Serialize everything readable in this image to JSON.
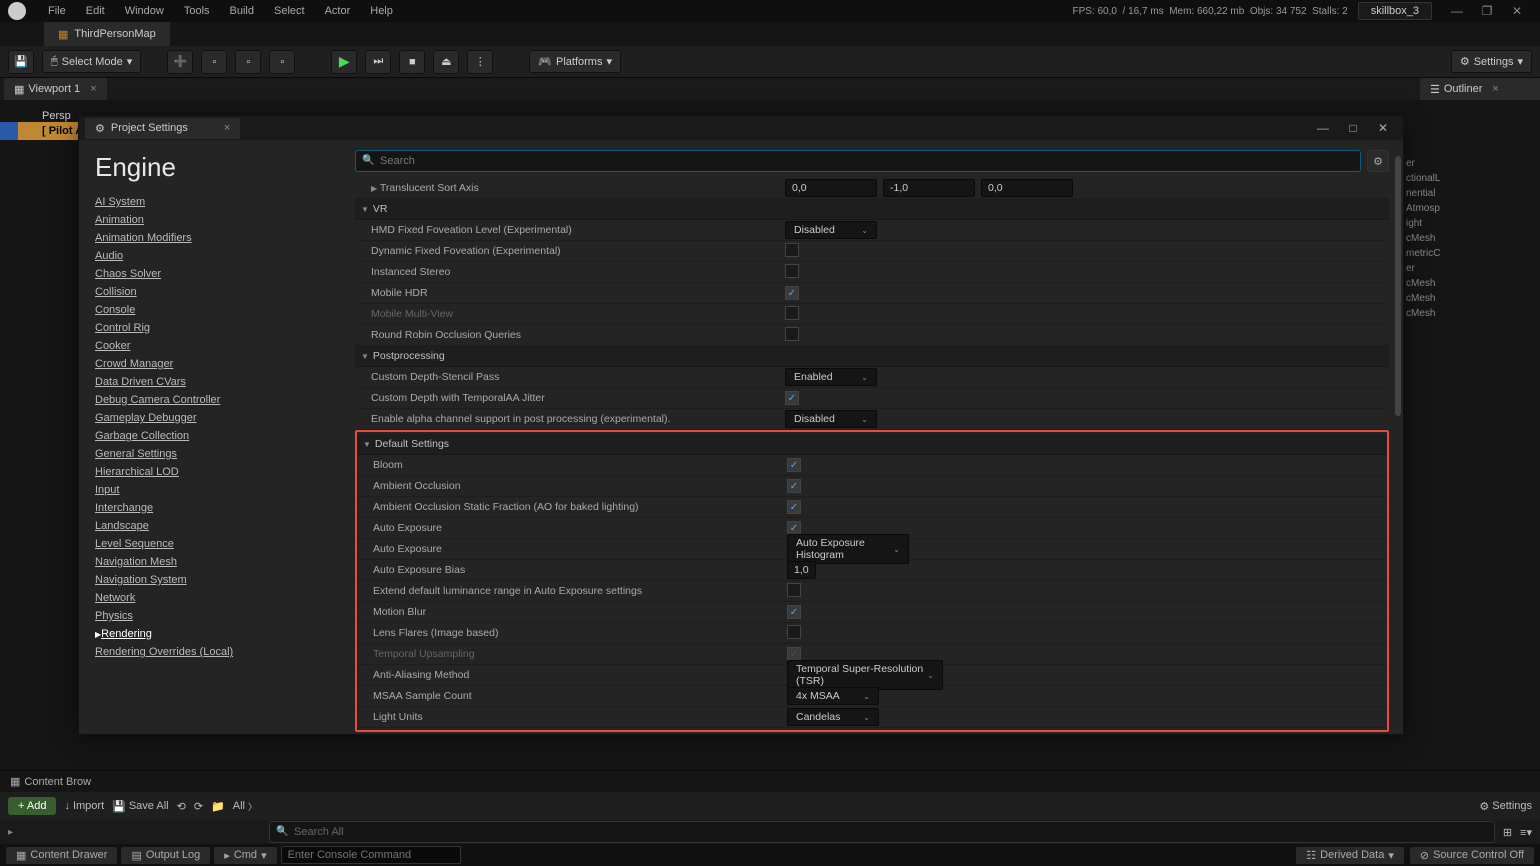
{
  "menu": [
    "File",
    "Edit",
    "Window",
    "Tools",
    "Build",
    "Select",
    "Actor",
    "Help"
  ],
  "stats": {
    "fps": "FPS: 60,0",
    "frame": "/ 16,7 ms",
    "mem": "Mem: 660,22 mb",
    "objs": "Objs: 34 752",
    "stalls": "Stalls: 2"
  },
  "user": "skillbox_3",
  "doc_tab": "ThirdPersonMap",
  "select_mode": "Select Mode",
  "platforms": "Platforms",
  "settings_label": "Settings",
  "viewport_tab": "Viewport 1",
  "outliner_tab": "Outliner",
  "outliner_items": [
    "er",
    "ctionalL",
    "nential",
    "Atmosp",
    "ight",
    "cMesh",
    "metricC",
    "er",
    "cMesh",
    "cMesh",
    "cMesh"
  ],
  "pilot": "[ Pilot A",
  "perspective": "Persp",
  "modal": {
    "title": "Project Settings",
    "search_placeholder": "Search",
    "sidebar_title": "Engine",
    "links": [
      "AI System",
      "Animation",
      "Animation Modifiers",
      "Audio",
      "Chaos Solver",
      "Collision",
      "Console",
      "Control Rig",
      "Cooker",
      "Crowd Manager",
      "Data Driven CVars",
      "Debug Camera Controller",
      "Gameplay Debugger",
      "Garbage Collection",
      "General Settings",
      "Hierarchical LOD",
      "Input",
      "Interchange",
      "Landscape",
      "Level Sequence",
      "Navigation Mesh",
      "Navigation System",
      "Network",
      "Physics",
      "Rendering",
      "Rendering Overrides (Local)"
    ]
  },
  "rows": {
    "translucent": "Translucent Sort Axis",
    "translucent_vals": [
      "0,0",
      "-1,0",
      "0,0"
    ],
    "vr": "VR",
    "hmd": "HMD Fixed Foveation Level (Experimental)",
    "hmd_val": "Disabled",
    "dyn_fov": "Dynamic Fixed Foveation (Experimental)",
    "inst_stereo": "Instanced Stereo",
    "mobile_hdr": "Mobile HDR",
    "mobile_mv": "Mobile Multi-View",
    "round_robin": "Round Robin Occlusion Queries",
    "postproc": "Postprocessing",
    "depth_pass": "Custom Depth-Stencil Pass",
    "depth_pass_val": "Enabled",
    "depth_jitter": "Custom Depth with TemporalAA Jitter",
    "alpha": "Enable alpha channel support in post processing (experimental).",
    "alpha_val": "Disabled",
    "defaults": "Default Settings",
    "bloom": "Bloom",
    "ao": "Ambient Occlusion",
    "ao_static": "Ambient Occlusion Static Fraction (AO for baked lighting)",
    "auto_exp": "Auto Exposure",
    "auto_exp2": "Auto Exposure",
    "auto_exp2_val": "Auto Exposure Histogram",
    "auto_exp_bias": "Auto Exposure Bias",
    "auto_exp_bias_val": "1,0",
    "extend_lum": "Extend default luminance range in Auto Exposure settings",
    "motion_blur": "Motion Blur",
    "lens_flares": "Lens Flares (Image based)",
    "temporal_up": "Temporal Upsampling",
    "aa_method": "Anti-Aliasing Method",
    "aa_method_val": "Temporal Super-Resolution (TSR)",
    "msaa": "MSAA Sample Count",
    "msaa_val": "4x MSAA",
    "light_units": "Light Units",
    "light_units_val": "Candelas"
  },
  "bottom": {
    "content_browser": "Content Brow",
    "add": "Add",
    "import": "Import",
    "save_all": "Save All",
    "all": "All",
    "search_all": "Search All",
    "settings": "Settings",
    "content_drawer": "Content Drawer",
    "output_log": "Output Log",
    "cmd": "Cmd",
    "cmd_placeholder": "Enter Console Command",
    "derived": "Derived Data",
    "source_ctrl": "Source Control Off"
  }
}
